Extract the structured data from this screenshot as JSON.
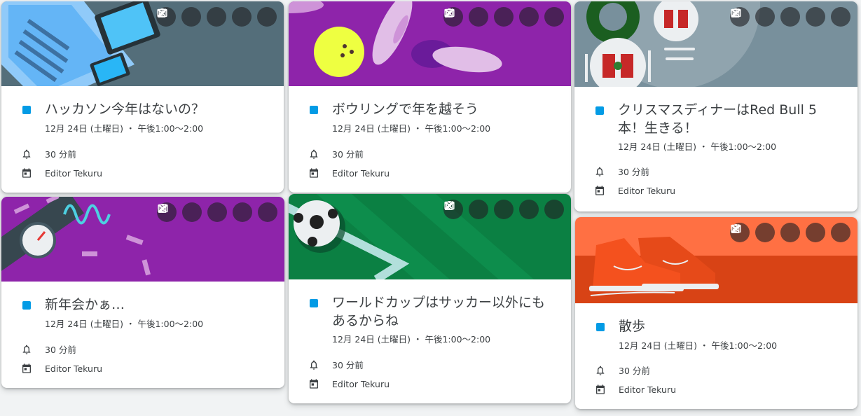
{
  "common": {
    "reminder": "30 分前",
    "calendar": "Editor Tekuru",
    "accent": "#039be5"
  },
  "events": [
    {
      "title": "ハッカソン今年はないの？",
      "when": "12月 24日 (土曜日) ・ 午後1:00～2:00",
      "reminder": "30 分前",
      "calendar": "Editor Tekuru"
    },
    {
      "title": "ボウリングで年を越そう",
      "when": "12月 24日 (土曜日) ・ 午後1:00～2:00",
      "reminder": "30 分前",
      "calendar": "Editor Tekuru"
    },
    {
      "title": "クリスマスディナーはRed Bull 5本！生きる！",
      "when": "12月 24日 (土曜日) ・ 午後1:00～2:00",
      "reminder": "30 分前",
      "calendar": "Editor Tekuru"
    },
    {
      "title": "新年会かぁ…",
      "when": "12月 24日 (土曜日) ・ 午後1:00～2:00",
      "reminder": "30 分前",
      "calendar": "Editor Tekuru"
    },
    {
      "title": "ワールドカップはサッカー以外にもあるからね",
      "when": "12月 24日 (土曜日) ・ 午後1:00～2:00",
      "reminder": "30 分前",
      "calendar": "Editor Tekuru"
    },
    {
      "title": "散歩",
      "when": "12月 24日 (土曜日) ・ 午後1:00～2:00",
      "reminder": "30 分前",
      "calendar": "Editor Tekuru"
    }
  ],
  "banner_colors": {
    "laptop": "#546e7a",
    "bowling": "#8e24aa",
    "christmas": "#78909c",
    "newyear": "#8e24aa",
    "soccer": "#0b8043",
    "shoes": "#e64a19"
  },
  "action_icons": [
    "edit-icon",
    "delete-icon",
    "email-icon",
    "more-options-icon",
    "close-icon"
  ]
}
